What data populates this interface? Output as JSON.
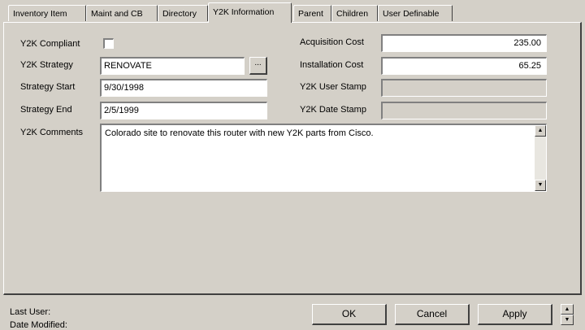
{
  "tabs": [
    {
      "label": "Inventory Item",
      "active": false
    },
    {
      "label": "Maint and CB",
      "active": false
    },
    {
      "label": "Directory",
      "active": false
    },
    {
      "label": "Y2K Information",
      "active": true
    },
    {
      "label": "Parent",
      "active": false
    },
    {
      "label": "Children",
      "active": false
    },
    {
      "label": "User Definable",
      "active": false
    }
  ],
  "form": {
    "compliant_label": "Y2K Compliant",
    "compliant_checked": false,
    "strategy_label": "Y2K Strategy",
    "strategy_value": "RENOVATE",
    "strategy_browse": "...",
    "start_label": "Strategy Start",
    "start_value": "9/30/1998",
    "end_label": "Strategy End",
    "end_value": "2/5/1999",
    "comments_label": "Y2K Comments",
    "comments_value": "Colorado site to renovate this router with new Y2K parts from Cisco.",
    "acq_label": "Acquisition Cost",
    "acq_value": "235.00",
    "install_label": "Installation Cost",
    "install_value": "65.25",
    "user_stamp_label": "Y2K User Stamp",
    "user_stamp_value": "",
    "date_stamp_label": "Y2K Date Stamp",
    "date_stamp_value": ""
  },
  "footer": {
    "last_user_label": "Last User:",
    "date_modified_label": "Date Modified:",
    "ok_label": "OK",
    "cancel_label": "Cancel",
    "apply_label": "Apply"
  },
  "icons": {
    "scroll_up": "▲",
    "scroll_down": "▼"
  }
}
